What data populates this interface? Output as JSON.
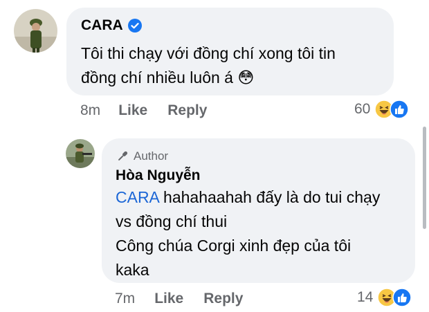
{
  "comments": [
    {
      "author": "CARA",
      "verified": true,
      "lines": [
        "Tôi thi chạy với đồng chí xong tôi tin",
        "đồng chí nhiều luôn á 😳"
      ],
      "time": "8m",
      "like_label": "Like",
      "reply_label": "Reply",
      "reaction_count": "60"
    }
  ],
  "reply": {
    "badge": "Author",
    "author": "Hòa Nguyễn",
    "mention": "CARA",
    "first_line_rest": " hahahaahah đấy là do tui chạy",
    "lines": [
      "vs đồng chí thui",
      "Công chúa Corgi xinh đẹp của tôi",
      "kaka"
    ],
    "time": "7m",
    "like_label": "Like",
    "reply_label": "Reply",
    "reaction_count": "14"
  },
  "colors": {
    "bubble": "#f0f2f5",
    "mention": "#1b66d6",
    "meta": "#65676b",
    "verified": "#1877f2"
  }
}
